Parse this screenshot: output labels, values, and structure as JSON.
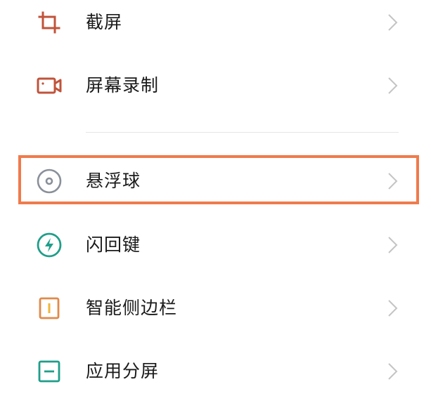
{
  "items": [
    {
      "label": "截屏",
      "icon": "crop-icon",
      "color": "#c0533a"
    },
    {
      "label": "屏幕录制",
      "icon": "video-camera-icon",
      "color": "#c0533a"
    },
    {
      "label": "悬浮球",
      "icon": "floating-ball-icon",
      "color": "#8a9099"
    },
    {
      "label": "闪回键",
      "icon": "lightning-bolt-icon",
      "color": "#1f9e8a"
    },
    {
      "label": "智能侧边栏",
      "icon": "sidebar-icon",
      "color": "#e08a4a"
    },
    {
      "label": "应用分屏",
      "icon": "split-screen-icon",
      "color": "#1f9e8a"
    }
  ],
  "highlight_color": "#ef7b4c",
  "chevron_icon": "chevron-right-icon"
}
